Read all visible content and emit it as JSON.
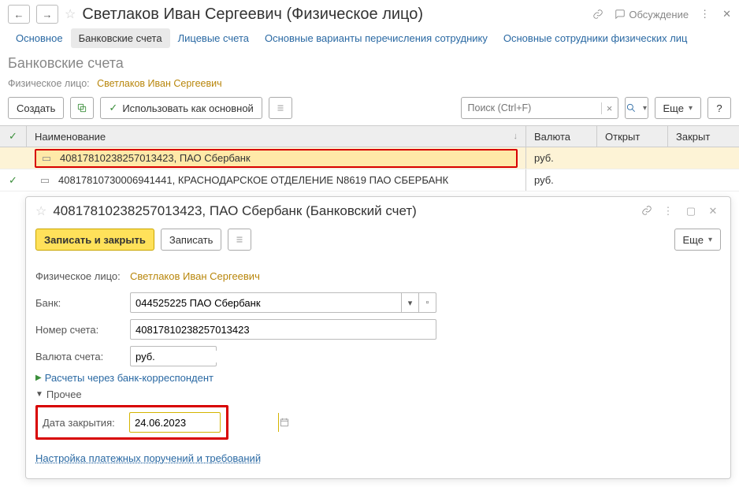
{
  "header": {
    "page_title": "Светлаков Иван Сергеевич (Физическое лицо)",
    "discussion_label": "Обсуждение"
  },
  "tabs": {
    "main": "Основное",
    "bank_accounts": "Банковские счета",
    "personal_accounts": "Лицевые счета",
    "transfer_variants": "Основные варианты перечисления сотруднику",
    "main_persons": "Основные сотрудники физических лиц"
  },
  "list": {
    "section_title": "Банковские счета",
    "person_label": "Физическое лицо:",
    "person_value": "Светлаков Иван Сергеевич",
    "toolbar": {
      "create": "Создать",
      "use_as_main": "Использовать как основной",
      "search_placeholder": "Поиск (Ctrl+F)",
      "more": "Еще"
    },
    "columns": {
      "name": "Наименование",
      "currency": "Валюта",
      "opened": "Открыт",
      "closed": "Закрыт"
    },
    "rows": [
      {
        "name": "40817810238257013423, ПАО Сбербанк",
        "currency": "руб.",
        "checked": false,
        "highlight": true
      },
      {
        "name": "40817810730006941441, КРАСНОДАРСКОЕ ОТДЕЛЕНИЕ N8619 ПАО СБЕРБАНК",
        "currency": "руб.",
        "checked": true,
        "highlight": false
      }
    ]
  },
  "card": {
    "title": "40817810238257013423, ПАО Сбербанк (Банковский счет)",
    "toolbar": {
      "save_close": "Записать и закрыть",
      "save": "Записать",
      "more": "Еще"
    },
    "person_label": "Физическое лицо:",
    "person_value": "Светлаков Иван Сергеевич",
    "bank_label": "Банк:",
    "bank_value": "044525225 ПАО Сбербанк",
    "acc_label": "Номер счета:",
    "acc_value": "40817810238257013423",
    "cur_label": "Валюта счета:",
    "cur_value": "руб.",
    "corr_bank": "Расчеты через банк-корреспондент",
    "other": "Прочее",
    "closed_label": "Дата закрытия:",
    "closed_value": "24.06.2023",
    "link": "Настройка платежных поручений и требований"
  }
}
